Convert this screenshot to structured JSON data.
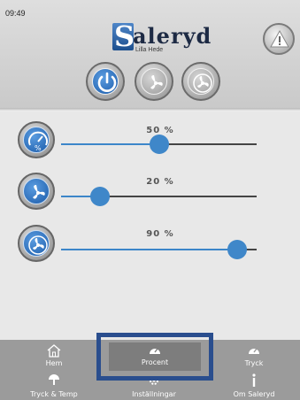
{
  "status": {
    "time": "09:49"
  },
  "brand": {
    "initial": "S",
    "name": "aleryd",
    "subtitle": "Lilla Hede"
  },
  "icons": {
    "warning": "warning-triangle-icon",
    "power": "power-icon",
    "fan": "fan-icon",
    "fan_round": "fan-round-icon",
    "gauge": "gauge-percent-icon"
  },
  "colors": {
    "accent": "#3f87c9",
    "brand_blue": "#1d4f8e",
    "selected_border": "#2a4e8e"
  },
  "sliders": [
    {
      "value": 50,
      "label": "50 %"
    },
    {
      "value": 20,
      "label": "20 %"
    },
    {
      "value": 90,
      "label": "90 %"
    }
  ],
  "nav": {
    "hem": "Hem",
    "procent": "Procent",
    "tryck": "Tryck",
    "tryck_temp": "Tryck & Temp",
    "installningar": "Inställningar",
    "om": "Om Saleryd"
  }
}
